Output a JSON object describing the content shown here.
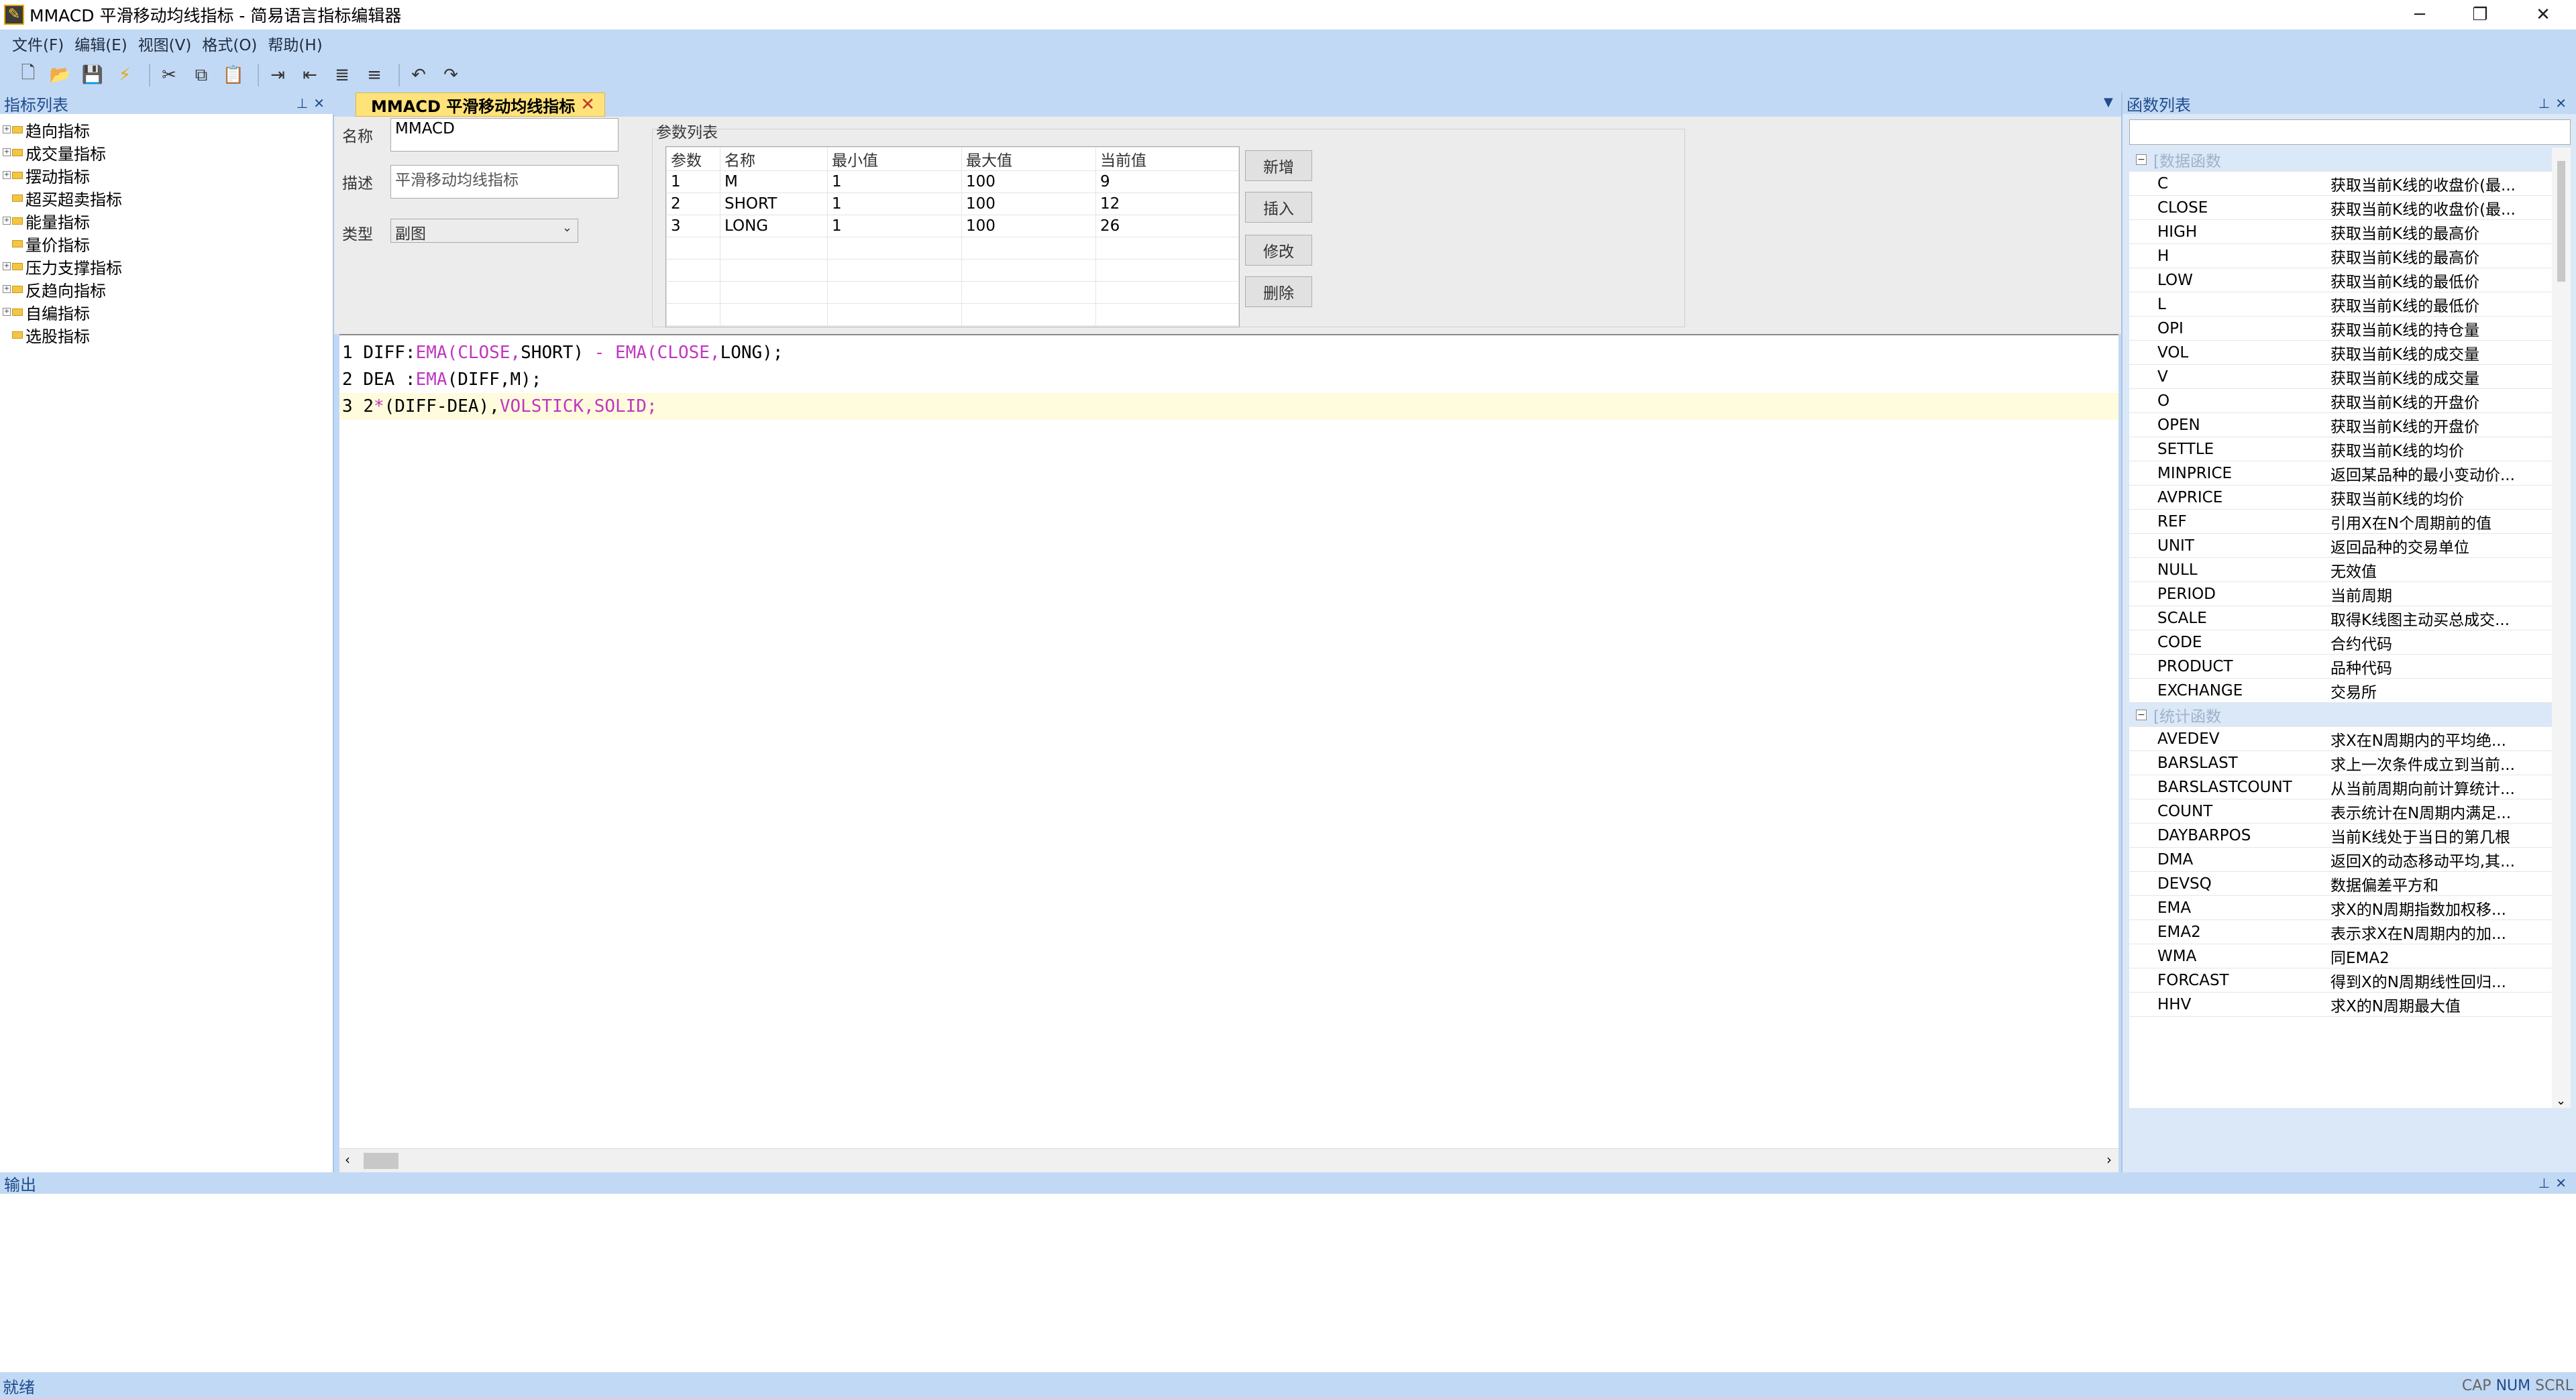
{
  "window": {
    "title": "MMACD 平滑移动均线指标 - 简易语言指标编辑器",
    "icon": "app-icon"
  },
  "menu": [
    "文件(F)",
    "编辑(E)",
    "视图(V)",
    "格式(O)",
    "帮助(H)"
  ],
  "left_panel": {
    "title": "指标列表",
    "items": [
      "趋向指标",
      "成交量指标",
      "摆动指标",
      "超买超卖指标",
      "能量指标",
      "量价指标",
      "压力支撑指标",
      "反趋向指标",
      "自编指标",
      "选股指标"
    ]
  },
  "doc_tab": {
    "label": "MMACD 平滑移动均线指标"
  },
  "form": {
    "name_label": "名称",
    "name_value": "MMACD",
    "desc_label": "描述",
    "desc_value": "平滑移动均线指标",
    "type_label": "类型",
    "type_value": "副图",
    "params_title": "参数列表",
    "param_headers": [
      "参数",
      "名称",
      "最小值",
      "最大值",
      "当前值"
    ],
    "params": [
      [
        "1",
        "M",
        "1",
        "100",
        "9"
      ],
      [
        "2",
        "SHORT",
        "1",
        "100",
        "12"
      ],
      [
        "3",
        "LONG",
        "1",
        "100",
        "26"
      ]
    ],
    "buttons": {
      "add": "新增",
      "insert": "插入",
      "modify": "修改",
      "delete": "删除"
    }
  },
  "code_lines": [
    {
      "num": "1",
      "parts": [
        [
          "DIFF:",
          ""
        ],
        [
          "EMA(CLOSE,",
          "fn"
        ],
        [
          "SHORT) ",
          ""
        ],
        [
          "- EMA(CLOSE,",
          "fn"
        ],
        [
          "LONG);",
          ""
        ]
      ]
    },
    {
      "num": "2",
      "parts": [
        [
          "DEA :",
          ""
        ],
        [
          "EMA",
          "fn"
        ],
        [
          "(DIFF,M);",
          ""
        ]
      ]
    },
    {
      "num": "3",
      "parts": [
        [
          "2",
          ""
        ],
        [
          "*",
          "fn"
        ],
        [
          "(DIFF-DEA),",
          ""
        ],
        [
          "VOLSTICK,SOLID;",
          "fn"
        ]
      ]
    }
  ],
  "right_panel": {
    "title": "函数列表",
    "categories": [
      {
        "name": "[数据函数",
        "items": [
          [
            "C",
            "获取当前K线的收盘价(最..."
          ],
          [
            "CLOSE",
            "获取当前K线的收盘价(最..."
          ],
          [
            "HIGH",
            "获取当前K线的最高价"
          ],
          [
            "H",
            "获取当前K线的最高价"
          ],
          [
            "LOW",
            "获取当前K线的最低价"
          ],
          [
            "L",
            "获取当前K线的最低价"
          ],
          [
            "OPI",
            "获取当前K线的持仓量"
          ],
          [
            "VOL",
            "获取当前K线的成交量"
          ],
          [
            "V",
            "获取当前K线的成交量"
          ],
          [
            "O",
            "获取当前K线的开盘价"
          ],
          [
            "OPEN",
            "获取当前K线的开盘价"
          ],
          [
            "SETTLE",
            "获取当前K线的均价"
          ],
          [
            "MINPRICE",
            "返回某品种的最小变动价..."
          ],
          [
            "AVPRICE",
            "获取当前K线的均价"
          ],
          [
            "REF",
            "引用X在N个周期前的值"
          ],
          [
            "UNIT",
            "返回品种的交易单位"
          ],
          [
            "NULL",
            "无效值"
          ],
          [
            "PERIOD",
            "当前周期"
          ],
          [
            "SCALE",
            "取得K线图主动买总成交..."
          ],
          [
            "CODE",
            "合约代码"
          ],
          [
            "PRODUCT",
            "品种代码"
          ],
          [
            "EXCHANGE",
            "交易所"
          ]
        ]
      },
      {
        "name": "[统计函数",
        "items": [
          [
            "AVEDEV",
            "求X在N周期内的平均绝..."
          ],
          [
            "BARSLAST",
            "求上一次条件成立到当前..."
          ],
          [
            "BARSLASTCOUNT",
            "从当前周期向前计算统计..."
          ],
          [
            "COUNT",
            "表示统计在N周期内满足..."
          ],
          [
            "DAYBARPOS",
            "当前K线处于当日的第几根"
          ],
          [
            "DMA",
            "返回X的动态移动平均,其..."
          ],
          [
            "DEVSQ",
            "数据偏差平方和"
          ],
          [
            "EMA",
            "求X的N周期指数加权移..."
          ],
          [
            "EMA2",
            "表示求X在N周期内的加..."
          ],
          [
            "WMA",
            "同EMA2"
          ],
          [
            "FORCAST",
            "得到X的N周期线性回归..."
          ],
          [
            "HHV",
            "求X的N周期最大值"
          ]
        ]
      }
    ]
  },
  "output_panel": {
    "title": "输出"
  },
  "status": {
    "text": "就绪",
    "cap": "CAP",
    "num": "NUM",
    "scrl": "SCRL"
  }
}
